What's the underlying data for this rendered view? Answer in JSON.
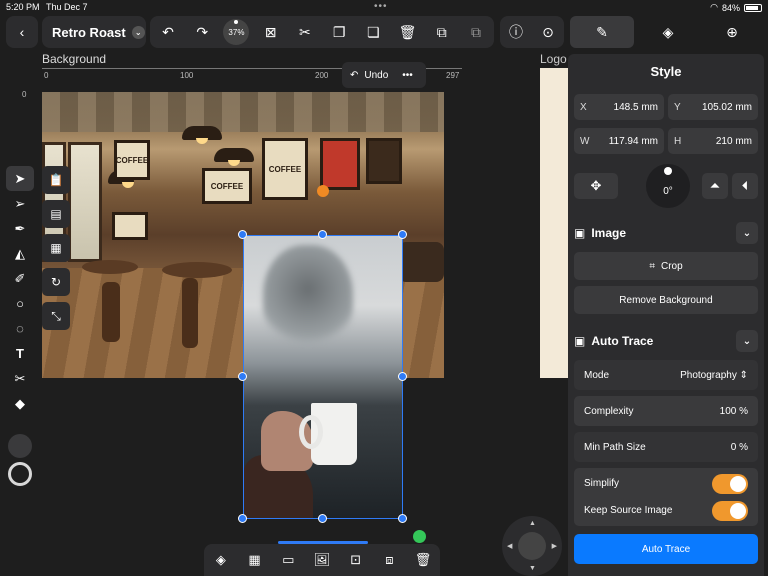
{
  "status_bar": {
    "time": "5:20 PM",
    "date": "Thu Dec 7",
    "battery": "84%"
  },
  "header": {
    "back_icon": "chevron-left-icon",
    "document_title": "Retro Roast",
    "zoom": "37%"
  },
  "canvas": {
    "layer_label": "Background",
    "logo_label": "Logo",
    "ruler_ticks": [
      "0",
      "100",
      "200",
      "297"
    ],
    "undo_label": "Undo"
  },
  "cafe_posters": [
    "COFFEE",
    "COFFEE",
    "COFFEE"
  ],
  "style_panel": {
    "title": "Style",
    "x_label": "X",
    "x_value": "148.5 mm",
    "y_label": "Y",
    "y_value": "105.02 mm",
    "w_label": "W",
    "w_value": "117.94 mm",
    "h_label": "H",
    "h_value": "210 mm",
    "rotation": "0°",
    "image_section": "Image",
    "crop_label": "Crop",
    "remove_bg_label": "Remove Background",
    "auto_trace_section": "Auto Trace",
    "mode_label": "Mode",
    "mode_value": "Photography",
    "complexity_label": "Complexity",
    "complexity_value": "100 %",
    "min_path_label": "Min Path Size",
    "min_path_value": "0 %",
    "simplify_label": "Simplify",
    "keep_source_label": "Keep Source Image",
    "auto_trace_button": "Auto Trace"
  },
  "colors": {
    "accent": "#2f7bf6",
    "toggle_on": "#f0982d",
    "primary": "#0a7aff",
    "handle_orange": "#f08a24",
    "handle_green": "#34c759"
  }
}
